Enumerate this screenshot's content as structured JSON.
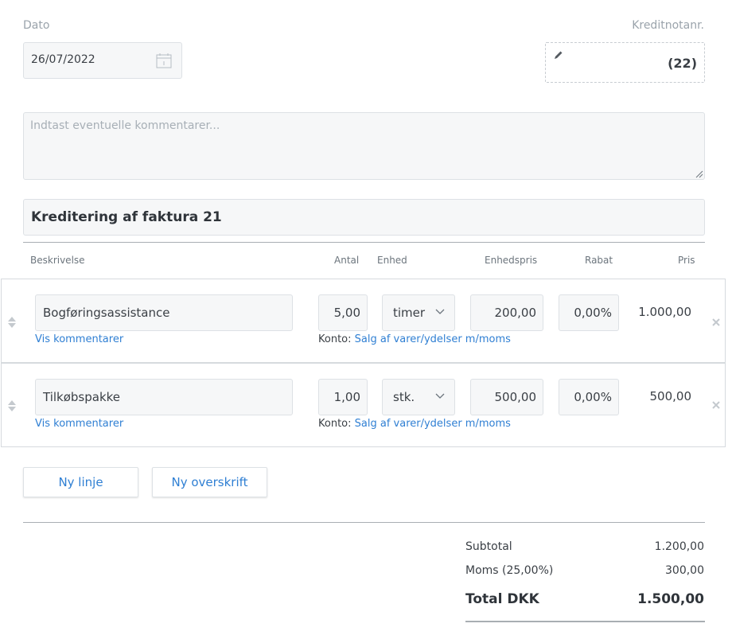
{
  "header": {
    "date_label": "Dato",
    "date_value": "26/07/2022",
    "credit_note_label": "Kreditnotanr.",
    "credit_note_number": "(22)"
  },
  "comments": {
    "placeholder": "Indtast eventuelle kommentarer..."
  },
  "heading": "Kreditering af faktura 21",
  "columns": {
    "description": "Beskrivelse",
    "quantity": "Antal",
    "unit": "Enhed",
    "unit_price": "Enhedspris",
    "discount": "Rabat",
    "price": "Pris"
  },
  "lines": [
    {
      "description": "Bogføringsassistance",
      "quantity": "5,00",
      "unit": "timer",
      "unit_price": "200,00",
      "discount": "0,00",
      "discount_suffix": "%",
      "price": "1.000,00",
      "comments_link": "Vis kommentarer",
      "account_label": "Konto:",
      "account_link": "Salg af varer/ydelser m/moms"
    },
    {
      "description": "Tilkøbspakke",
      "quantity": "1,00",
      "unit": "stk.",
      "unit_price": "500,00",
      "discount": "0,00",
      "discount_suffix": "%",
      "price": "500,00",
      "comments_link": "Vis kommentarer",
      "account_label": "Konto:",
      "account_link": "Salg af varer/ydelser m/moms"
    }
  ],
  "buttons": {
    "new_line": "Ny linje",
    "new_heading": "Ny overskrift"
  },
  "totals": {
    "subtotal_label": "Subtotal",
    "subtotal_value": "1.200,00",
    "vat_label": "Moms (25,00%)",
    "vat_value": "300,00",
    "total_label": "Total DKK",
    "total_value": "1.500,00"
  },
  "icons": {
    "calendar": "calendar-icon",
    "pencil": "pencil-icon",
    "drag": "drag-handle-icon",
    "remove": "close-icon",
    "chevron": "chevron-down-icon"
  },
  "colors": {
    "accent": "#2f7fd3",
    "field_bg": "#f6f7f8",
    "border": "#dde1e5"
  }
}
